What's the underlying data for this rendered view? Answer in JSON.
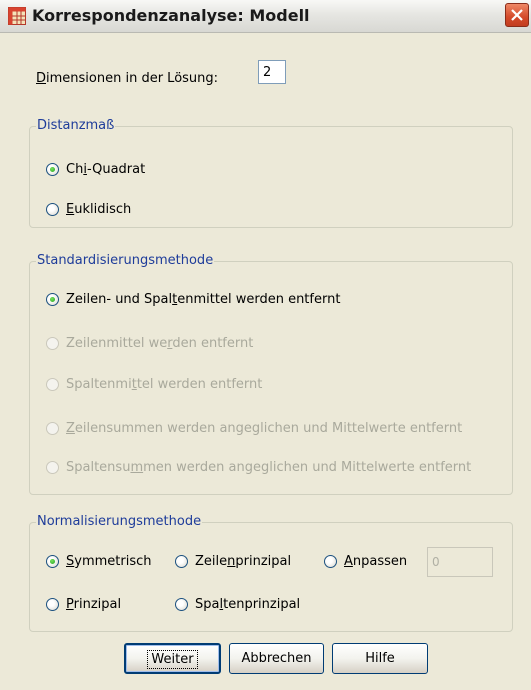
{
  "window": {
    "title": "Korrespondenzanalyse: Modell"
  },
  "dimensions": {
    "label_pre": "",
    "label_u": "D",
    "label_post": "imensionen in der Lösung:",
    "value": "2"
  },
  "distanz": {
    "legend": "Distanzmaß",
    "options": [
      {
        "pre": "Ch",
        "u": "i",
        "post": "-Quadrat",
        "selected": true,
        "enabled": true
      },
      {
        "pre": "",
        "u": "E",
        "post": "uklidisch",
        "selected": false,
        "enabled": true
      }
    ]
  },
  "standard": {
    "legend": "Standardisierungsmethode",
    "options": [
      {
        "pre": "Zeilen- und Spal",
        "u": "t",
        "post": "enmittel werden entfernt",
        "selected": true,
        "enabled": true
      },
      {
        "pre": "Zeilenmittel we",
        "u": "r",
        "post": "den entfernt",
        "selected": false,
        "enabled": false
      },
      {
        "pre": "Spaltenmi",
        "u": "t",
        "post": "tel werden entfernt",
        "selected": false,
        "enabled": false
      },
      {
        "pre": "",
        "u": "Z",
        "post": "eilensummen werden angeglichen und Mittelwerte entfernt",
        "selected": false,
        "enabled": false
      },
      {
        "pre": "Spaltensu",
        "u": "m",
        "post": "men werden angeglichen und Mittelwerte entfernt",
        "selected": false,
        "enabled": false
      }
    ]
  },
  "norm": {
    "legend": "Normalisierungsmethode",
    "symmetrisch": {
      "pre": "",
      "u": "S",
      "post": "ymmetrisch"
    },
    "zeilenprinzipal": {
      "pre": "Zeile",
      "u": "n",
      "post": "prinzipal"
    },
    "anpassen": {
      "pre": "",
      "u": "A",
      "post": "npassen"
    },
    "anpassen_value": "0",
    "prinzipal": {
      "pre": "",
      "u": "P",
      "post": "rinzipal"
    },
    "spaltenprinzipal": {
      "pre": "Spa",
      "u": "l",
      "post": "tenprinzipal"
    }
  },
  "buttons": {
    "weiter": "Weiter",
    "abbrechen": "Abbrechen",
    "hilfe": "Hilfe"
  },
  "colors": {
    "legend_blue": "#1e3c9a",
    "disabled_text": "#a9a99c",
    "close_red": "#d44a2a"
  }
}
